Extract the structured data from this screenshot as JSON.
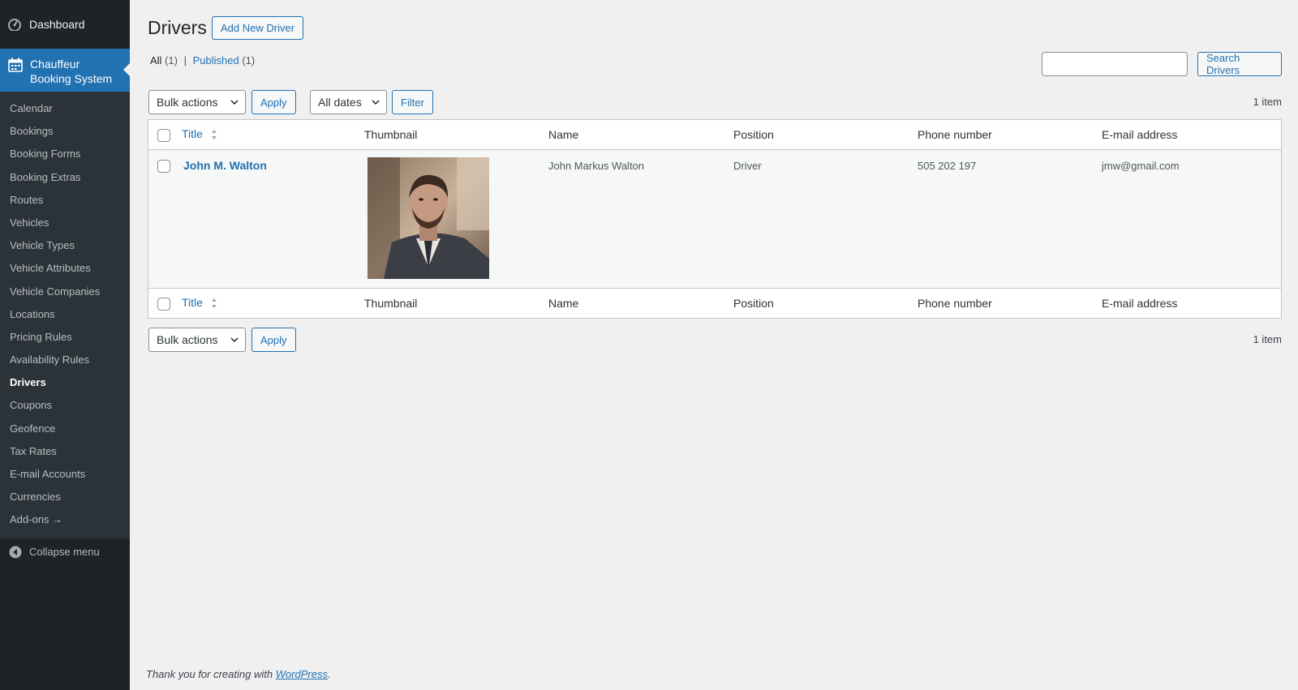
{
  "sidebar": {
    "dashboard": "Dashboard",
    "current": {
      "line1": "Chauffeur",
      "line2": "Booking System"
    },
    "items": [
      {
        "label": "Calendar"
      },
      {
        "label": "Bookings"
      },
      {
        "label": "Booking Forms"
      },
      {
        "label": "Booking Extras"
      },
      {
        "label": "Routes"
      },
      {
        "label": "Vehicles"
      },
      {
        "label": "Vehicle Types"
      },
      {
        "label": "Vehicle Attributes"
      },
      {
        "label": "Vehicle Companies"
      },
      {
        "label": "Locations"
      },
      {
        "label": "Pricing Rules"
      },
      {
        "label": "Availability Rules"
      },
      {
        "label": "Drivers",
        "active": true
      },
      {
        "label": "Coupons"
      },
      {
        "label": "Geofence"
      },
      {
        "label": "Tax Rates"
      },
      {
        "label": "E-mail Accounts"
      },
      {
        "label": "Currencies"
      },
      {
        "label": "Add-ons →"
      }
    ],
    "collapse": "Collapse menu"
  },
  "header": {
    "title": "Drivers",
    "add_new": "Add New Driver"
  },
  "views": {
    "all": "All",
    "all_count": "(1)",
    "separator": "|",
    "published": "Published",
    "published_count": "(1)"
  },
  "search": {
    "placeholder": "",
    "button": "Search Drivers"
  },
  "toolbar_top": {
    "bulk_actions": "Bulk actions",
    "apply": "Apply",
    "dates": "All dates",
    "filter": "Filter",
    "count": "1 item"
  },
  "toolbar_bottom": {
    "bulk_actions": "Bulk actions",
    "apply": "Apply",
    "count": "1 item"
  },
  "table": {
    "columns": [
      "Title",
      "Thumbnail",
      "Name",
      "Position",
      "Phone number",
      "E-mail address"
    ],
    "rows": [
      {
        "title": "John M. Walton",
        "name": "John Markus Walton",
        "position": "Driver",
        "phone": "505 202 197",
        "email": "jmw@gmail.com"
      }
    ]
  },
  "footer": {
    "text": "Thank you for creating with",
    "link": "WordPress",
    "end": "."
  },
  "colors": {
    "accent": "#2271b1",
    "sidebar": "#1d2327",
    "submenu": "#2c3338",
    "background": "#f0f0f1"
  }
}
